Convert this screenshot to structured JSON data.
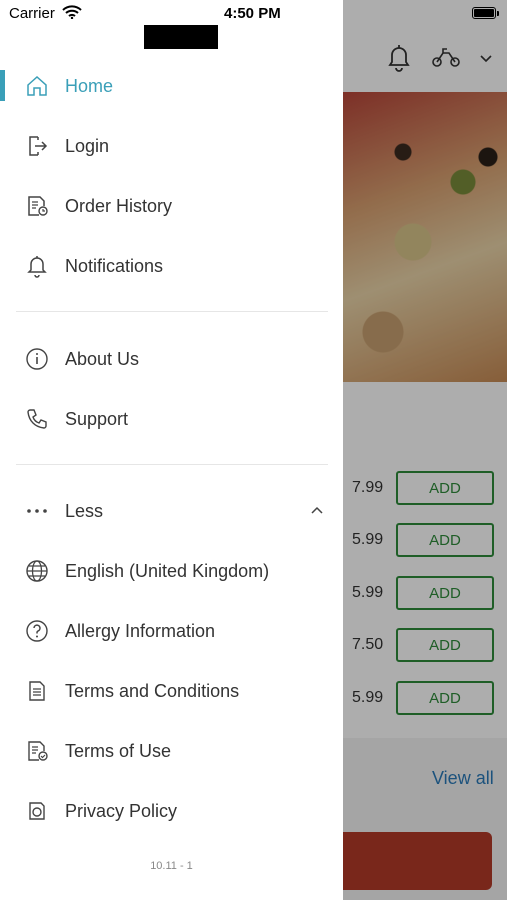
{
  "status_bar": {
    "carrier": "Carrier",
    "time": "4:50 PM"
  },
  "menu": {
    "primary": [
      {
        "label": "Home",
        "icon": "home-icon",
        "active": true
      },
      {
        "label": "Login",
        "icon": "login-icon"
      },
      {
        "label": "Order History",
        "icon": "order-history-icon"
      },
      {
        "label": "Notifications",
        "icon": "bell-icon"
      }
    ],
    "secondary": [
      {
        "label": "About Us",
        "icon": "info-icon"
      },
      {
        "label": "Support",
        "icon": "phone-icon"
      }
    ],
    "more": [
      {
        "label": "Less",
        "icon": "more-dots-icon"
      },
      {
        "label": "English (United Kingdom)",
        "icon": "globe-icon"
      },
      {
        "label": "Allergy Information",
        "icon": "question-icon"
      },
      {
        "label": "Terms and Conditions",
        "icon": "document-icon"
      },
      {
        "label": "Terms of Use",
        "icon": "document-check-icon"
      },
      {
        "label": "Privacy Policy",
        "icon": "privacy-icon"
      }
    ],
    "version": "10.11 - 1"
  },
  "background": {
    "prices": [
      "7.99",
      "5.99",
      "5.99",
      "7.50",
      "5.99"
    ],
    "add_label": "ADD",
    "view_all": "View all"
  },
  "colors": {
    "accent": "#3a9fb8",
    "add_green": "#2e8b3a",
    "cta": "#b33a28"
  }
}
